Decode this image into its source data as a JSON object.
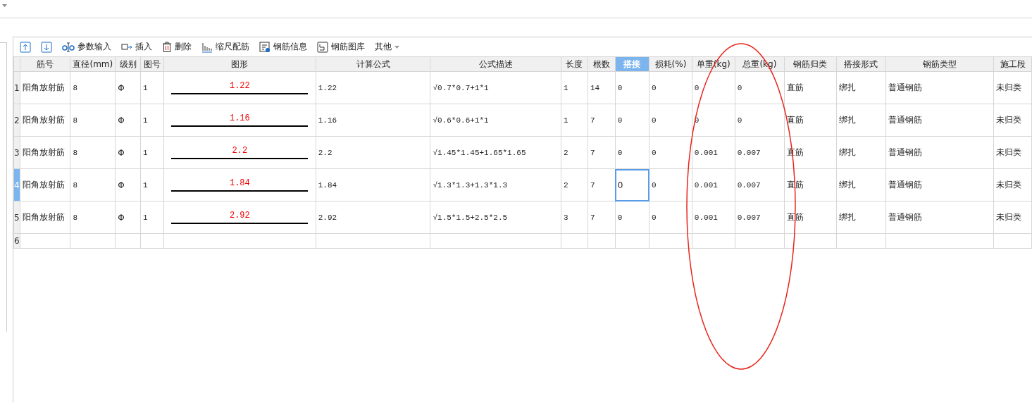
{
  "toolbar": [
    {
      "kind": "up"
    },
    {
      "kind": "down"
    },
    {
      "kind": "param",
      "label": "参数输入"
    },
    {
      "kind": "insert",
      "label": "插入"
    },
    {
      "kind": "delete",
      "label": "删除"
    },
    {
      "kind": "scale",
      "label": "缩尺配筋"
    },
    {
      "kind": "info",
      "label": "钢筋信息"
    },
    {
      "kind": "library",
      "label": "钢筋图库"
    },
    {
      "kind": "more",
      "label": "其他"
    }
  ],
  "table": {
    "columns": [
      {
        "label": "筋号",
        "kind": "text",
        "selected": false
      },
      {
        "label": "直径(mm)",
        "kind": "text",
        "selected": false
      },
      {
        "label": "级别",
        "kind": "text",
        "selected": false
      },
      {
        "label": "图号",
        "kind": "text",
        "selected": false
      },
      {
        "label": "图形",
        "kind": "shape",
        "selected": false
      },
      {
        "label": "计算公式",
        "kind": "text",
        "selected": false
      },
      {
        "label": "公式描述",
        "kind": "text",
        "selected": false
      },
      {
        "label": "长度",
        "kind": "text",
        "selected": false
      },
      {
        "label": "根数",
        "kind": "text",
        "selected": false
      },
      {
        "label": "搭接",
        "kind": "text",
        "selected": true
      },
      {
        "label": "损耗(%)",
        "kind": "text",
        "selected": false
      },
      {
        "label": "单重(kg)",
        "kind": "text",
        "selected": false
      },
      {
        "label": "总重(kg)",
        "kind": "text",
        "selected": false
      },
      {
        "label": "钢筋归类",
        "kind": "text",
        "selected": false
      },
      {
        "label": "搭接形式",
        "kind": "text",
        "selected": false
      },
      {
        "label": "钢筋类型",
        "kind": "text",
        "selected": false
      },
      {
        "label": "施工段",
        "kind": "text",
        "selected": false
      }
    ],
    "rows": [
      {
        "number": "1",
        "selected": false,
        "cells": [
          "阳角放射筋",
          "8",
          "Φ",
          "1",
          "1.22",
          "1.22",
          "√0.7*0.7+1*1",
          "1",
          "14",
          "0",
          "0",
          "0",
          "0",
          "直筋",
          "绑扎",
          "普通钢筋",
          "未归类"
        ]
      },
      {
        "number": "2",
        "selected": false,
        "cells": [
          "阳角放射筋",
          "8",
          "Φ",
          "1",
          "1.16",
          "1.16",
          "√0.6*0.6+1*1",
          "1",
          "7",
          "0",
          "0",
          "0",
          "0",
          "直筋",
          "绑扎",
          "普通钢筋",
          "未归类"
        ]
      },
      {
        "number": "3",
        "selected": false,
        "cells": [
          "阳角放射筋",
          "8",
          "Φ",
          "1",
          "2.2",
          "2.2",
          "√1.45*1.45+1.65*1.65",
          "2",
          "7",
          "0",
          "0",
          "0.001",
          "0.007",
          "直筋",
          "绑扎",
          "普通钢筋",
          "未归类"
        ]
      },
      {
        "number": "4",
        "selected": true,
        "cells": [
          "阳角放射筋",
          "8",
          "Φ",
          "1",
          "1.84",
          "1.84",
          "√1.3*1.3+1.3*1.3",
          "2",
          "7",
          "0",
          "0",
          "0.001",
          "0.007",
          "直筋",
          "绑扎",
          "普通钢筋",
          "未归类"
        ]
      },
      {
        "number": "5",
        "selected": false,
        "cells": [
          "阳角放射筋",
          "8",
          "Φ",
          "1",
          "2.92",
          "2.92",
          "√1.5*1.5+2.5*2.5",
          "3",
          "7",
          "0",
          "0",
          "0.001",
          "0.007",
          "直筋",
          "绑扎",
          "普通钢筋",
          "未归类"
        ]
      },
      {
        "number": "6",
        "selected": false
      }
    ]
  }
}
